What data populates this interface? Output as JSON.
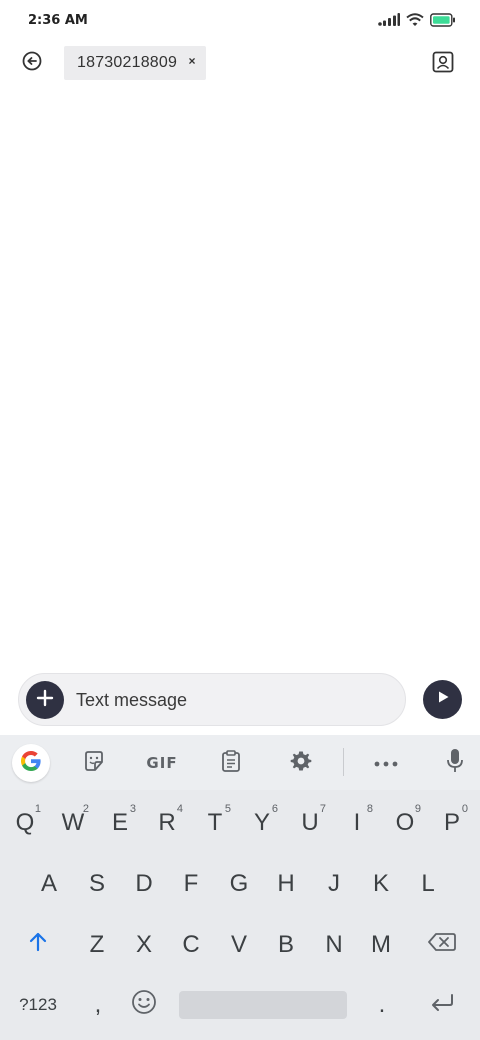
{
  "status_bar": {
    "time": "2:36 AM"
  },
  "header": {
    "recipient": "18730218809",
    "chip_close": "×"
  },
  "compose": {
    "placeholder": "Text message"
  },
  "keyboard": {
    "toolbar": {
      "gif_label": "GIF"
    },
    "row1": [
      {
        "label": "Q",
        "hint": "1"
      },
      {
        "label": "W",
        "hint": "2"
      },
      {
        "label": "E",
        "hint": "3"
      },
      {
        "label": "R",
        "hint": "4"
      },
      {
        "label": "T",
        "hint": "5"
      },
      {
        "label": "Y",
        "hint": "6"
      },
      {
        "label": "U",
        "hint": "7"
      },
      {
        "label": "I",
        "hint": "8"
      },
      {
        "label": "O",
        "hint": "9"
      },
      {
        "label": "P",
        "hint": "0"
      }
    ],
    "row2": [
      "A",
      "S",
      "D",
      "F",
      "G",
      "H",
      "J",
      "K",
      "L"
    ],
    "row3": [
      "Z",
      "X",
      "C",
      "V",
      "B",
      "N",
      "M"
    ],
    "row4": {
      "symbols": "?123",
      "comma": ",",
      "period": "."
    }
  }
}
